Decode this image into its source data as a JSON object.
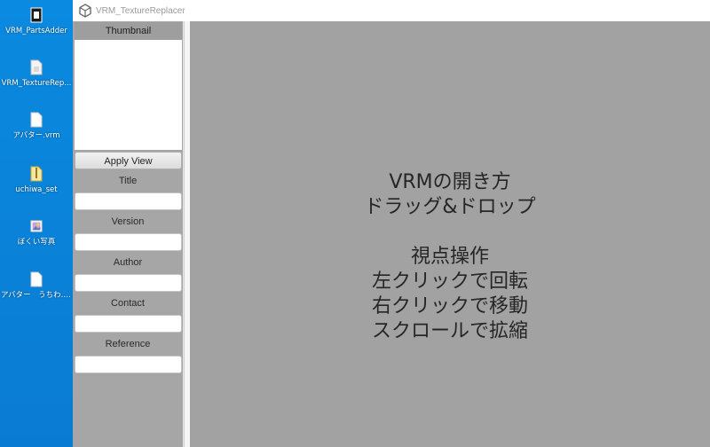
{
  "desktop": {
    "icons": [
      {
        "label": "VRM_PartsAdder",
        "icon": "exe-icon"
      },
      {
        "label": "VRM_TextureRep...",
        "icon": "file-icon"
      },
      {
        "label": "アバター.vrm",
        "icon": "vrm-file-icon"
      },
      {
        "label": "uchiwa_set",
        "icon": "zip-icon"
      },
      {
        "label": "ぼくい写真",
        "icon": "image-icon"
      },
      {
        "label": "アバター　うちわ.vrm",
        "icon": "vrm-file-icon"
      }
    ]
  },
  "window": {
    "title": "VRM_TextureReplacer"
  },
  "panel": {
    "thumbnail_label": "Thumbnail",
    "apply_view_label": "Apply View",
    "fields": [
      {
        "label": "Title",
        "value": ""
      },
      {
        "label": "Version",
        "value": ""
      },
      {
        "label": "Author",
        "value": ""
      },
      {
        "label": "Contact",
        "value": ""
      },
      {
        "label": "Reference",
        "value": ""
      }
    ]
  },
  "viewport": {
    "lines": [
      "VRMの開き方",
      "ドラッグ&ドロップ",
      "",
      "視点操作",
      "左クリックで回転",
      "右クリックで移動",
      "スクロールで拡縮"
    ]
  }
}
